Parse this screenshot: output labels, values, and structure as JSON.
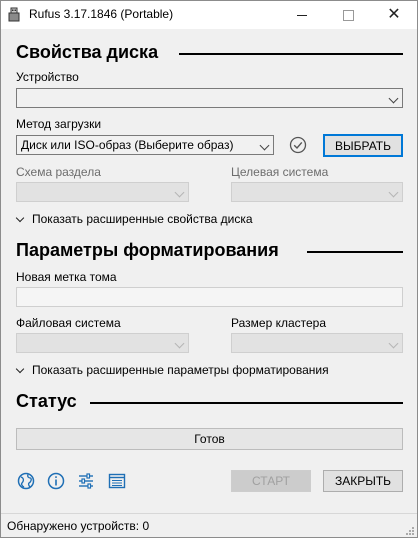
{
  "window": {
    "title": "Rufus 3.17.1846 (Portable)",
    "close_glyph": "✕"
  },
  "drive": {
    "section_title": "Свойства диска",
    "device_label": "Устройство",
    "device_value": "",
    "boot_label": "Метод загрузки",
    "boot_value": "Диск или ISO-образ (Выберите образ)",
    "select_button": "ВЫБРАТЬ",
    "partition_label": "Схема раздела",
    "partition_value": "",
    "target_label": "Целевая система",
    "target_value": "",
    "advanced_toggle": "Показать расширенные свойства диска"
  },
  "format": {
    "section_title": "Параметры форматирования",
    "volume_label": "Новая метка тома",
    "volume_value": "",
    "fs_label": "Файловая система",
    "fs_value": "",
    "cluster_label": "Размер кластера",
    "cluster_value": "",
    "advanced_toggle": "Показать расширенные параметры форматирования"
  },
  "status": {
    "section_title": "Статус",
    "progress_text": "Готов",
    "progress": 0
  },
  "toolbar": {
    "icons": [
      "globe-icon",
      "info-icon",
      "settings-sliders-icon",
      "log-icon"
    ],
    "start_button": "СТАРТ",
    "close_button": "ЗАКРЫТЬ"
  },
  "statusbar": {
    "text": "Обнаружено устройств: 0"
  },
  "colors": {
    "accent": "#0078d7",
    "icon_blue": "#1f6fb5",
    "background": "#f0f0f0"
  }
}
